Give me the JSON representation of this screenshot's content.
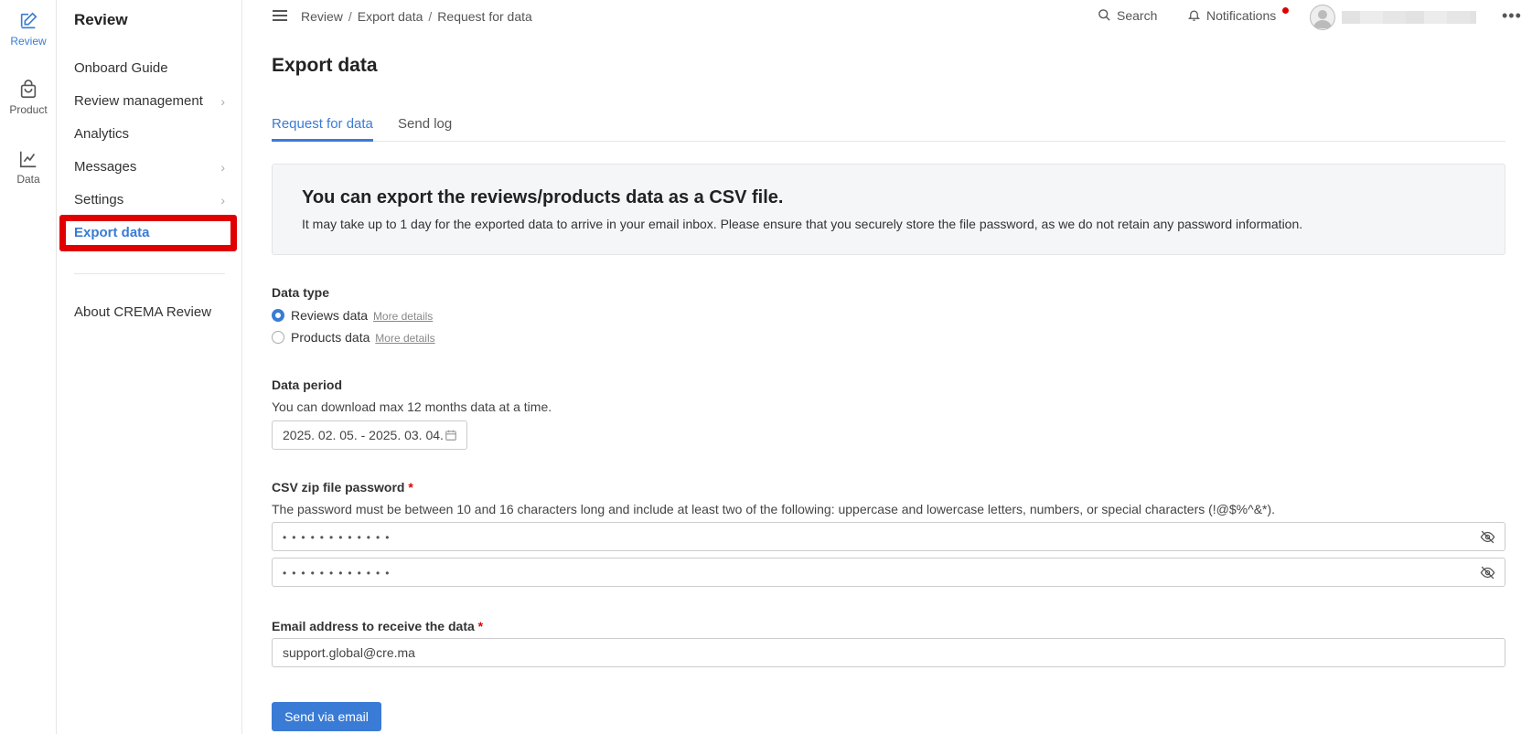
{
  "rail": {
    "items": [
      {
        "label": "Review",
        "icon": "pencil-square-icon",
        "active": true
      },
      {
        "label": "Product",
        "icon": "shopping-bag-icon"
      },
      {
        "label": "Data",
        "icon": "line-chart-icon"
      }
    ]
  },
  "sidebar": {
    "title": "Review",
    "items": [
      {
        "label": "Onboard Guide"
      },
      {
        "label": "Review management",
        "chevron": "›"
      },
      {
        "label": "Analytics"
      },
      {
        "label": "Messages",
        "chevron": "›"
      },
      {
        "label": "Settings",
        "chevron": "›"
      },
      {
        "label": "Export data",
        "active": true
      }
    ],
    "footer_item": "About CREMA Review"
  },
  "header": {
    "breadcrumb": [
      "Review",
      "Export data",
      "Request for data"
    ],
    "breadcrumb_sep": "/",
    "search_label": "Search",
    "notifications_label": "Notifications",
    "more_label": "•••"
  },
  "main": {
    "title": "Export data",
    "tabs": [
      {
        "label": "Request for data",
        "active": true
      },
      {
        "label": "Send log"
      }
    ],
    "info": {
      "heading": "You can export the reviews/products data as a CSV file.",
      "text": "It may take up to 1 day for the exported data to arrive in your email inbox. Please ensure that you securely store the file password, as we do not retain any password information."
    },
    "data_type": {
      "label": "Data type",
      "options": [
        {
          "label": "Reviews data",
          "link": "More details",
          "checked": true
        },
        {
          "label": "Products data",
          "link": "More details",
          "checked": false
        }
      ]
    },
    "data_period": {
      "label": "Data period",
      "helper": "You can download max 12 months data at a time.",
      "value": "2025. 02. 05. - 2025. 03. 04."
    },
    "password": {
      "label": "CSV zip file password",
      "required": "*",
      "helper": "The password must be between 10 and 16 characters long and include at least two of the following: uppercase and lowercase letters, numbers, or special characters (!@$%^&*).",
      "value_mask": "••••••••••••",
      "confirm_mask": "••••••••••••"
    },
    "email": {
      "label": "Email address to receive the data",
      "required": "*",
      "value": "support.global@cre.ma"
    },
    "submit_label": "Send via email"
  },
  "colors": {
    "accent": "#3a7bd5",
    "highlight": "#e00000",
    "notification_dot": "#e00000"
  }
}
